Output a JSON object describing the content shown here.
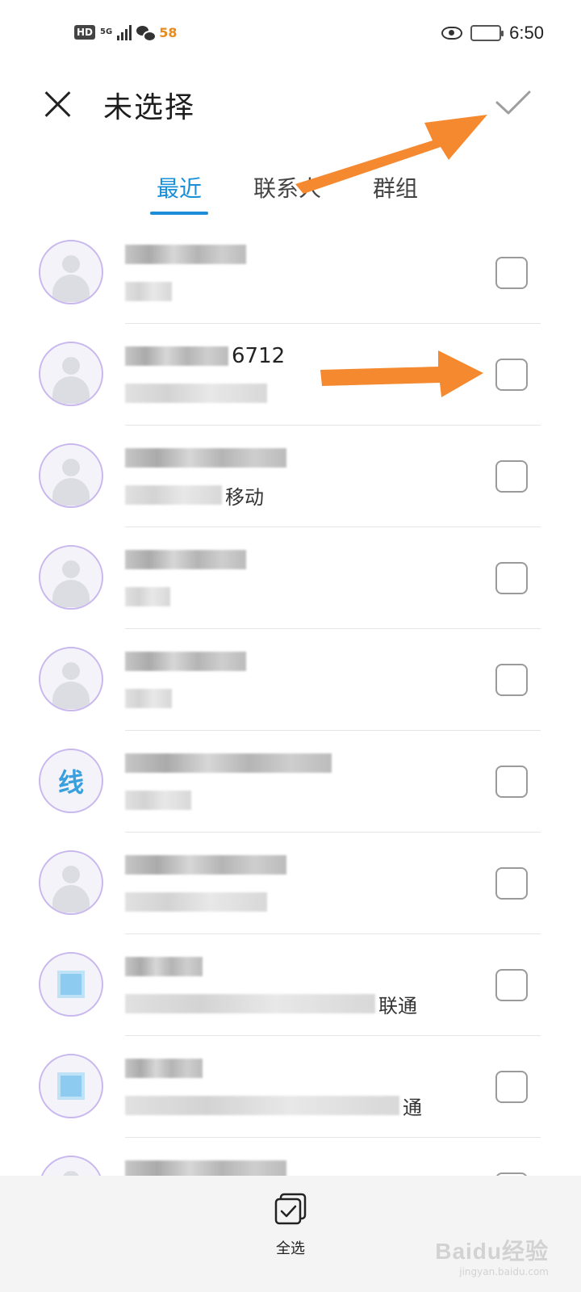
{
  "status_bar": {
    "hd": "HD",
    "network": "5G",
    "app_badge": "58",
    "time": "6:50",
    "battery_level": 0.2,
    "icons": [
      "hd-icon",
      "signal-icon",
      "wechat-icon",
      "app58-icon",
      "eye-icon",
      "battery-icon"
    ]
  },
  "header": {
    "title": "未选择",
    "close_icon": "close-icon",
    "confirm_icon": "check-icon"
  },
  "tabs": [
    {
      "label": "最近",
      "active": true
    },
    {
      "label": "联系人",
      "active": false
    },
    {
      "label": "群组",
      "active": false
    }
  ],
  "contacts": [
    {
      "avatar": "person",
      "name_visible": "",
      "sub_visible": ""
    },
    {
      "avatar": "person",
      "name_visible": "6712",
      "sub_visible": ""
    },
    {
      "avatar": "person",
      "name_visible": "",
      "sub_visible": "移动"
    },
    {
      "avatar": "person",
      "name_visible": "",
      "sub_visible": ""
    },
    {
      "avatar": "person",
      "name_visible": "",
      "sub_visible": ""
    },
    {
      "avatar": "线",
      "name_visible": "",
      "sub_visible": ""
    },
    {
      "avatar": "person",
      "name_visible": "",
      "sub_visible": ""
    },
    {
      "avatar": "square",
      "name_visible": "",
      "sub_visible": "联通"
    },
    {
      "avatar": "square",
      "name_visible": "",
      "sub_visible": "通"
    },
    {
      "avatar": "person",
      "name_visible": "",
      "sub_visible": ""
    }
  ],
  "bottom_bar": {
    "select_all_label": "全选",
    "select_all_icon": "select-all-icon"
  },
  "watermark": {
    "logo": "Baidu经验",
    "url": "jingyan.baidu.com"
  },
  "colors": {
    "accent": "#1a8fd8",
    "arrow": "#f5892f",
    "avatar_ring": "#c9b8ee"
  }
}
